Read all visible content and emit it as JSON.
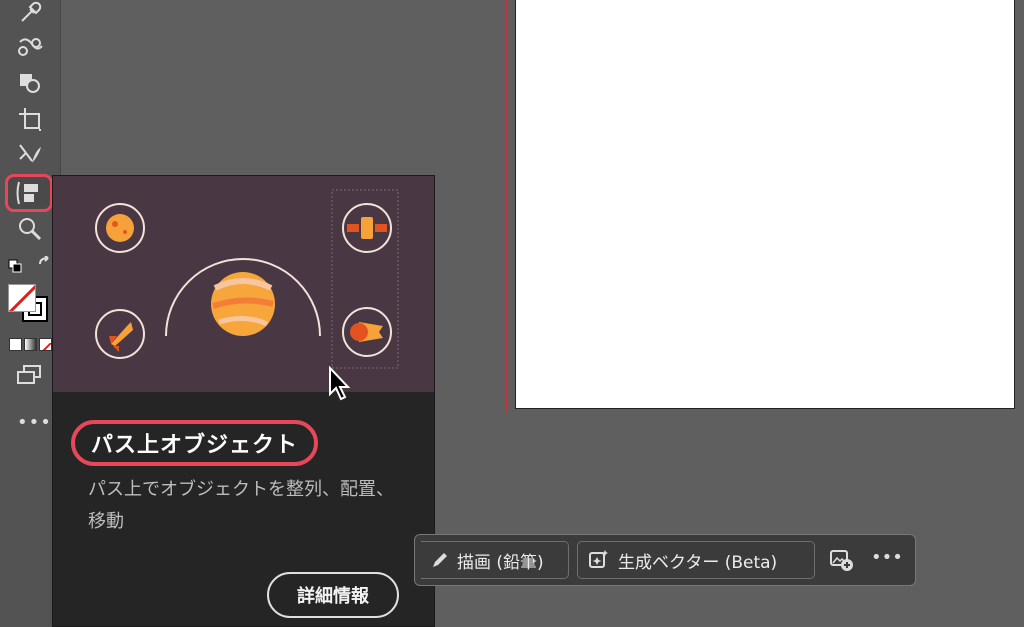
{
  "toolbar": {
    "tools": [
      {
        "name": "eyedropper-tool",
        "icon": "eyedropper-icon"
      },
      {
        "name": "blend-tool",
        "icon": "blend-icon"
      },
      {
        "name": "shape-builder-tool",
        "icon": "shape-builder-icon"
      },
      {
        "name": "artboard-tool",
        "icon": "artboard-icon"
      },
      {
        "name": "slice-tool",
        "icon": "slice-icon"
      },
      {
        "name": "objects-on-path-tool",
        "icon": "objects-on-path-icon",
        "highlighted": true
      },
      {
        "name": "zoom-tool",
        "icon": "zoom-icon"
      }
    ],
    "more_label": "•••"
  },
  "flyout": {
    "title": "パス上オブジェクト",
    "description": "パス上でオブジェクトを整列、配置、移動",
    "details_button": "詳細情報"
  },
  "taskbar": {
    "draw_label": "描画 (鉛筆)",
    "generate_label": "生成ベクター (Beta)",
    "more_label": "•••"
  },
  "colors": {
    "highlight": "#e8475a",
    "accent_orange": "#f5a623",
    "illustration_bg": "#4a3744"
  }
}
